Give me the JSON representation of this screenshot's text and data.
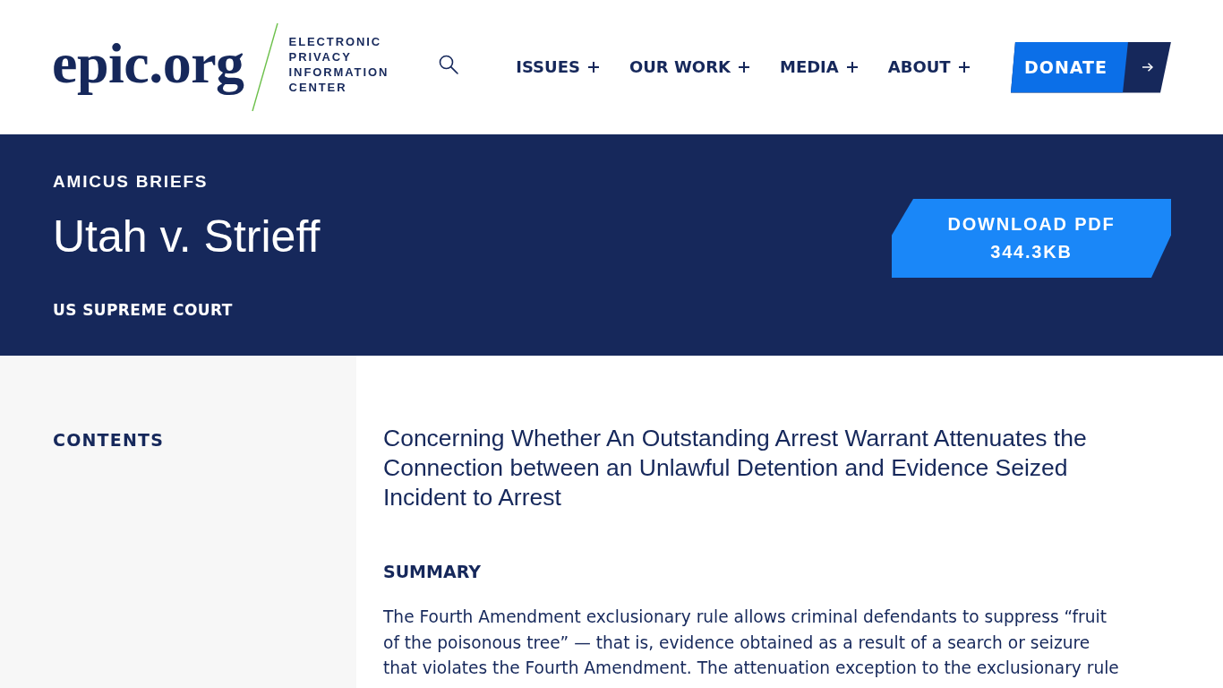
{
  "header": {
    "logo": {
      "wordmark": "epic.org",
      "tagline": [
        "ELECTRONIC",
        "PRIVACY",
        "INFORMATION",
        "CENTER"
      ]
    },
    "nav": [
      {
        "label": "ISSUES"
      },
      {
        "label": "OUR WORK"
      },
      {
        "label": "MEDIA"
      },
      {
        "label": "ABOUT"
      }
    ],
    "donate": {
      "label": "DONATE"
    }
  },
  "banner": {
    "category": "AMICUS BRIEFS",
    "title": "Utah v. Strieff",
    "court": "US SUPREME COURT",
    "download": {
      "label": "DOWNLOAD PDF",
      "size": "344.3KB"
    }
  },
  "sidebar": {
    "heading": "CONTENTS"
  },
  "article": {
    "subtitle": "Concerning Whether An Outstanding Arrest Warrant Attenuates the Connection between an Unlawful Detention and Evidence Seized Incident to Arrest",
    "sections": [
      {
        "heading": "SUMMARY",
        "paragraphs": [
          "The Fourth Amendment exclusionary rule allows criminal defendants to suppress “fruit of the poisonous tree” — that is, evidence obtained as a result of a search or seizure that violates the Fourth Amendment. The attenuation exception to the exclusionary rule"
        ]
      }
    ]
  }
}
